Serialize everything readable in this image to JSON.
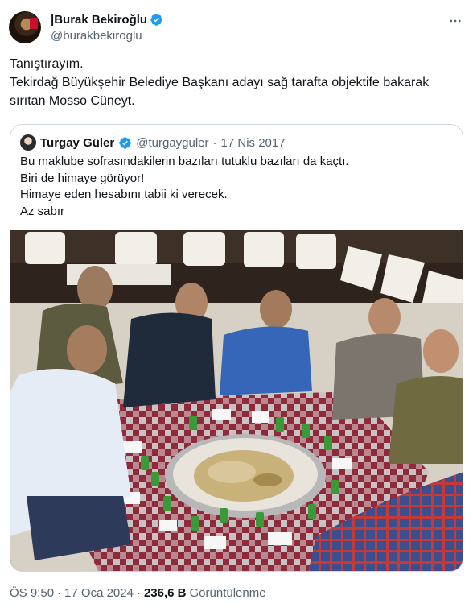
{
  "author": {
    "display_name": "|Burak Bekiroğlu",
    "handle": "@burakbekiroglu",
    "verified_color": "#1d9bf0"
  },
  "tweet": {
    "text": "Tanıştırayım.\nTekirdağ Büyükşehir Belediye Başkanı adayı sağ tarafta objektife bakarak sırıtan Mosso Cüneyt."
  },
  "quoted": {
    "display_name": "Turgay Güler",
    "handle": "@turgayguler",
    "separator": "·",
    "date": "17 Nis 2017",
    "text": "Bu maklube sofrasındakilerin bazıları tutuklu bazıları da kaçtı.\nBiri de himaye görüyor!\nHimaye eden hesabını tabii ki verecek.\nAz sabır",
    "photo_icon": "dinner-photo"
  },
  "footer": {
    "time": "ÖS 9:50",
    "separator1": "·",
    "date": "17 Oca 2024",
    "separator2": "·",
    "views_count": "236,6 B",
    "views_label": "Görüntülenme"
  },
  "icons": {
    "more": "more-icon",
    "verified": "verified-badge-icon"
  }
}
